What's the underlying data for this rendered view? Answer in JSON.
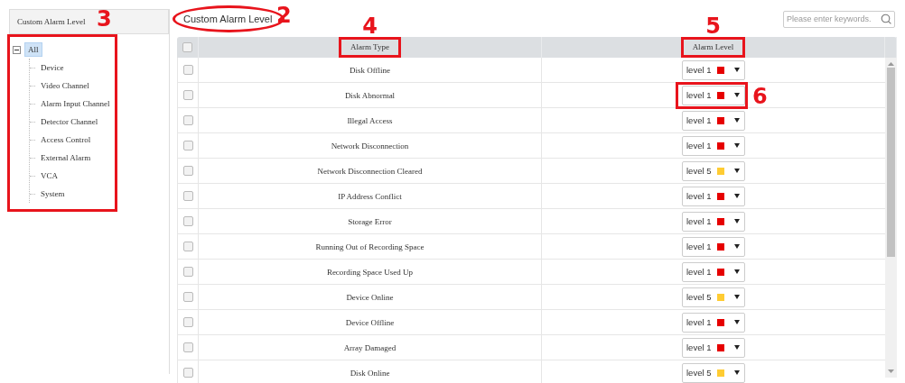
{
  "sidebar": {
    "title": "Custom Alarm Level",
    "annotation": {
      "number": "3",
      "kind": "box"
    },
    "tree": [
      {
        "label": "All",
        "selected": true,
        "expanded": true,
        "children": [
          {
            "label": "Device",
            "selected": false
          },
          {
            "label": "Video Channel",
            "selected": false
          },
          {
            "label": "Alarm Input Channel",
            "selected": false
          },
          {
            "label": "Detector Channel",
            "selected": false
          },
          {
            "label": "Access Control",
            "selected": false
          },
          {
            "label": "External Alarm",
            "selected": false
          },
          {
            "label": "VCA",
            "selected": false
          },
          {
            "label": "System",
            "selected": false
          }
        ]
      }
    ]
  },
  "toolbar": {
    "title_button": {
      "label": "Custom Alarm Level",
      "annotation": {
        "number": "2",
        "kind": "ellipse"
      }
    },
    "search": {
      "placeholder": "Please enter keywords."
    }
  },
  "table": {
    "header_checkbox": {
      "checked": false
    },
    "columns": [
      {
        "label": "Alarm Type",
        "annotation": {
          "number": "4",
          "kind": "box"
        }
      },
      {
        "label": "Alarm Level",
        "annotation": {
          "number": "5",
          "kind": "box"
        }
      }
    ],
    "rows": [
      {
        "checked": false,
        "alarm_type": "Disk Offline",
        "level": "level 1",
        "color": "#e60000"
      },
      {
        "checked": false,
        "alarm_type": "Disk Abnormal",
        "level": "level 1",
        "color": "#e60000",
        "annotation": {
          "number": "6",
          "kind": "box"
        }
      },
      {
        "checked": false,
        "alarm_type": "Illegal Access",
        "level": "level 1",
        "color": "#e60000"
      },
      {
        "checked": false,
        "alarm_type": "Network Disconnection",
        "level": "level 1",
        "color": "#e60000"
      },
      {
        "checked": false,
        "alarm_type": "Network Disconnection Cleared",
        "level": "level 5",
        "color": "#ffcc33"
      },
      {
        "checked": false,
        "alarm_type": "IP Address Conflict",
        "level": "level 1",
        "color": "#e60000"
      },
      {
        "checked": false,
        "alarm_type": "Storage Error",
        "level": "level 1",
        "color": "#e60000"
      },
      {
        "checked": false,
        "alarm_type": "Running Out of Recording Space",
        "level": "level 1",
        "color": "#e60000"
      },
      {
        "checked": false,
        "alarm_type": "Recording Space Used Up",
        "level": "level 1",
        "color": "#e60000"
      },
      {
        "checked": false,
        "alarm_type": "Device Online",
        "level": "level 5",
        "color": "#ffcc33"
      },
      {
        "checked": false,
        "alarm_type": "Device Offline",
        "level": "level 1",
        "color": "#e60000"
      },
      {
        "checked": false,
        "alarm_type": "Array Damaged",
        "level": "level 1",
        "color": "#e60000"
      },
      {
        "checked": false,
        "alarm_type": "Disk Online",
        "level": "level 5",
        "color": "#ffcc33"
      }
    ]
  }
}
